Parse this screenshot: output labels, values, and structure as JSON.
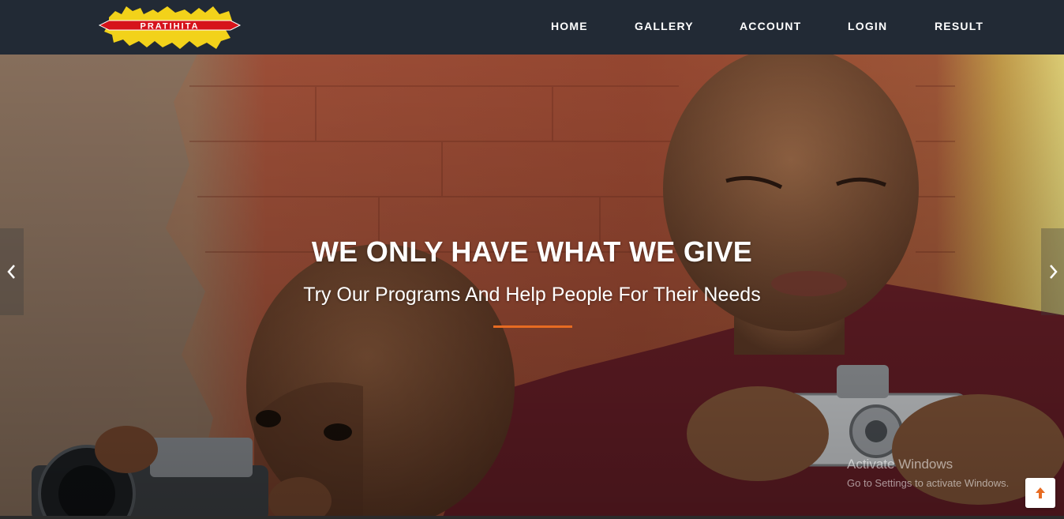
{
  "brand": {
    "logo_text": "PRATIHITA"
  },
  "nav": {
    "items": [
      {
        "label": "HOME"
      },
      {
        "label": "GALLERY"
      },
      {
        "label": "ACCOUNT"
      },
      {
        "label": "LOGIN"
      },
      {
        "label": "RESULT"
      }
    ]
  },
  "hero": {
    "title": "WE ONLY HAVE WHAT WE GIVE",
    "subtitle": "Try Our Programs And Help People For Their Needs",
    "prev_icon": "chevron-left-icon",
    "next_icon": "chevron-right-icon"
  },
  "watermark": {
    "title": "Activate Windows",
    "subtitle": "Go to Settings to activate Windows."
  },
  "scroll_top": {
    "icon": "arrow-up-icon"
  },
  "colors": {
    "navbar_bg": "#222a35",
    "accent": "#e76b22",
    "logo_yellow": "#f2d21a",
    "logo_red": "#d6131b"
  }
}
